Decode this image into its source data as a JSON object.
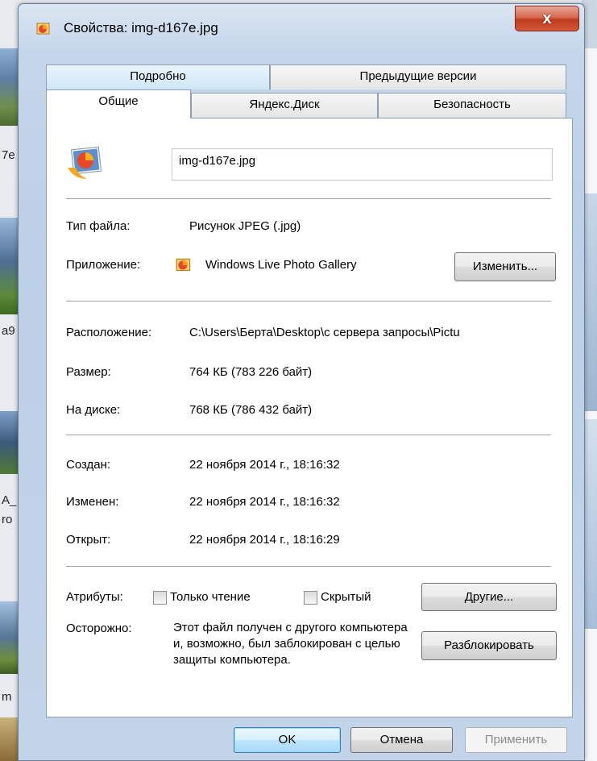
{
  "window": {
    "title": "Свойства: img-d167e.jpg",
    "close_glyph": "x"
  },
  "tabs_row1": [
    "Подробно",
    "Предыдущие версии"
  ],
  "tabs_row2": [
    "Общие",
    "Яндекс.Диск",
    "Безопасность"
  ],
  "general": {
    "file_name": "img-d167e.jpg",
    "file_type_label": "Тип файла:",
    "file_type_value": "Рисунок JPEG (.jpg)",
    "app_label": "Приложение:",
    "app_value": "Windows Live Photo Gallery",
    "change_button": "Изменить...",
    "location_label": "Расположение:",
    "location_value": "C:\\Users\\Берта\\Desktop\\с сервера запросы\\Pictu",
    "size_label": "Размер:",
    "size_value": "764 КБ (783 226 байт)",
    "disk_label": "На диске:",
    "disk_value": "768 КБ (786 432 байт)",
    "created_label": "Создан:",
    "created_value": "22 ноября 2014 г., 18:16:32",
    "modified_label": "Изменен:",
    "modified_value": "22 ноября 2014 г., 18:16:32",
    "opened_label": "Открыт:",
    "opened_value": "22 ноября 2014 г., 18:16:29",
    "attributes_label": "Атрибуты:",
    "readonly_label": "Только чтение",
    "hidden_label": "Скрытый",
    "other_button": "Другие...",
    "warning_label": "Осторожно:",
    "warning_text": "Этот файл получен с другого компьютера и, возможно, был заблокирован с целью защиты компьютера.",
    "unblock_button": "Разблокировать"
  },
  "footer": {
    "ok": "OK",
    "cancel": "Отмена",
    "apply": "Применить"
  },
  "background": {
    "fragments": [
      "7e",
      "a9",
      "A_",
      "ro",
      "m"
    ]
  }
}
